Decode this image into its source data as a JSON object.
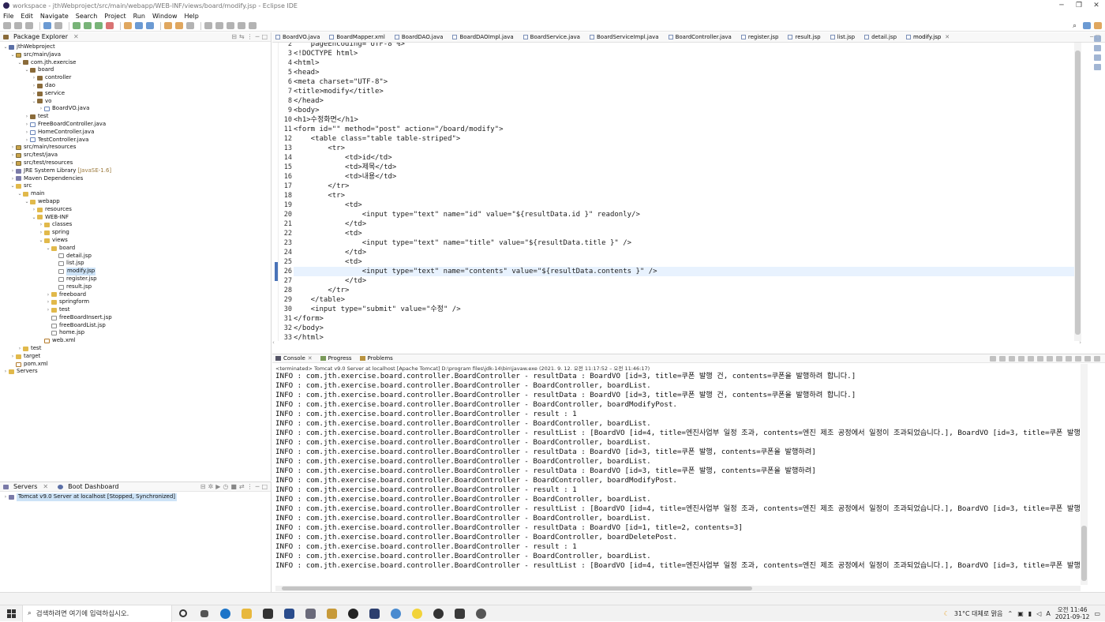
{
  "window": {
    "title": "workspace - jthWebproject/src/main/webapp/WEB-INF/views/board/modify.jsp - Eclipse IDE"
  },
  "menu": [
    "File",
    "Edit",
    "Navigate",
    "Search",
    "Project",
    "Run",
    "Window",
    "Help"
  ],
  "package_explorer": {
    "title": "Package Explorer",
    "tree": [
      {
        "label": "jthWebproject",
        "depth": 0,
        "icon": "project-icon",
        "expanded": true
      },
      {
        "label": "src/main/java",
        "depth": 1,
        "icon": "source-folder-icon",
        "expanded": true
      },
      {
        "label": "com.jth.exercise",
        "depth": 2,
        "icon": "package-icon",
        "expanded": true
      },
      {
        "label": "board",
        "depth": 3,
        "icon": "package-icon",
        "expanded": true
      },
      {
        "label": "controller",
        "depth": 4,
        "icon": "package-icon",
        "expanded": false
      },
      {
        "label": "dao",
        "depth": 4,
        "icon": "package-icon",
        "expanded": false
      },
      {
        "label": "service",
        "depth": 4,
        "icon": "package-icon",
        "expanded": false
      },
      {
        "label": "vo",
        "depth": 4,
        "icon": "package-icon",
        "expanded": true
      },
      {
        "label": "BoardVO.java",
        "depth": 5,
        "icon": "java-file-icon",
        "expanded": false
      },
      {
        "label": "test",
        "depth": 3,
        "icon": "package-icon",
        "expanded": false
      },
      {
        "label": "FreeBoardController.java",
        "depth": 3,
        "icon": "java-file-icon",
        "expanded": false
      },
      {
        "label": "HomeController.java",
        "depth": 3,
        "icon": "java-file-icon",
        "expanded": false
      },
      {
        "label": "TestController.java",
        "depth": 3,
        "icon": "java-file-icon",
        "expanded": false
      },
      {
        "label": "src/main/resources",
        "depth": 1,
        "icon": "source-folder-icon",
        "expanded": false
      },
      {
        "label": "src/test/java",
        "depth": 1,
        "icon": "source-folder-icon",
        "expanded": false
      },
      {
        "label": "src/test/resources",
        "depth": 1,
        "icon": "source-folder-icon",
        "expanded": false
      },
      {
        "label": "JRE System Library",
        "tag": "[JavaSE-1.6]",
        "depth": 1,
        "icon": "library-icon",
        "expanded": false
      },
      {
        "label": "Maven Dependencies",
        "depth": 1,
        "icon": "library-icon",
        "expanded": false
      },
      {
        "label": "src",
        "depth": 1,
        "icon": "folder-icon",
        "expanded": true
      },
      {
        "label": "main",
        "depth": 2,
        "icon": "folder-icon",
        "expanded": true
      },
      {
        "label": "webapp",
        "depth": 3,
        "icon": "folder-icon",
        "expanded": true
      },
      {
        "label": "resources",
        "depth": 4,
        "icon": "folder-icon",
        "expanded": false
      },
      {
        "label": "WEB-INF",
        "depth": 4,
        "icon": "folder-icon",
        "expanded": true
      },
      {
        "label": "classes",
        "depth": 5,
        "icon": "folder-icon",
        "expanded": false
      },
      {
        "label": "spring",
        "depth": 5,
        "icon": "folder-icon",
        "expanded": false
      },
      {
        "label": "views",
        "depth": 5,
        "icon": "folder-icon",
        "expanded": true
      },
      {
        "label": "board",
        "depth": 6,
        "icon": "folder-icon",
        "expanded": true
      },
      {
        "label": "detail.jsp",
        "depth": 7,
        "icon": "jsp-file-icon",
        "expanded": false
      },
      {
        "label": "list.jsp",
        "depth": 7,
        "icon": "jsp-file-icon",
        "expanded": false
      },
      {
        "label": "modify.jsp",
        "depth": 7,
        "icon": "jsp-file-icon",
        "expanded": false,
        "selected": true
      },
      {
        "label": "register.jsp",
        "depth": 7,
        "icon": "jsp-file-icon",
        "expanded": false
      },
      {
        "label": "result.jsp",
        "depth": 7,
        "icon": "jsp-file-icon",
        "expanded": false
      },
      {
        "label": "freeboard",
        "depth": 6,
        "icon": "folder-icon",
        "expanded": false
      },
      {
        "label": "springform",
        "depth": 6,
        "icon": "folder-icon",
        "expanded": false
      },
      {
        "label": "test",
        "depth": 6,
        "icon": "folder-icon",
        "expanded": false
      },
      {
        "label": "freeBoardInsert.jsp",
        "depth": 6,
        "icon": "jsp-file-icon",
        "expanded": false
      },
      {
        "label": "freeBoardList.jsp",
        "depth": 6,
        "icon": "jsp-file-icon",
        "expanded": false
      },
      {
        "label": "home.jsp",
        "depth": 6,
        "icon": "jsp-file-icon",
        "expanded": false
      },
      {
        "label": "web.xml",
        "depth": 5,
        "icon": "xml-file-icon",
        "expanded": false
      },
      {
        "label": "test",
        "depth": 2,
        "icon": "folder-icon",
        "expanded": false
      },
      {
        "label": "target",
        "depth": 1,
        "icon": "folder-icon",
        "expanded": false
      },
      {
        "label": "pom.xml",
        "depth": 1,
        "icon": "xml-file-icon",
        "expanded": false
      },
      {
        "label": "Servers",
        "depth": 0,
        "icon": "folder-icon",
        "expanded": false
      }
    ]
  },
  "servers_panel": {
    "tabs": [
      "Servers",
      "Boot Dashboard"
    ],
    "server": "Tomcat v9.0 Server at localhost  [Stopped, Synchronized]"
  },
  "editor": {
    "tabs": [
      "BoardVO.java",
      "BoardMapper.xml",
      "BoardDAO.java",
      "BoardDAOImpl.java",
      "BoardService.java",
      "BoardServiceImpl.java",
      "BoardController.java",
      "register.jsp",
      "result.jsp",
      "list.jsp",
      "detail.jsp",
      "modify.jsp"
    ],
    "active_tab": "modify.jsp",
    "current_line": 26,
    "lines": [
      {
        "n": "2",
        "text": "    pageEncoding=\"UTF-8\"%>"
      },
      {
        "n": "3",
        "text": "<!DOCTYPE html>"
      },
      {
        "n": "4",
        "text": "<html>"
      },
      {
        "n": "5",
        "text": "<head>"
      },
      {
        "n": "6",
        "text": "<meta charset=\"UTF-8\">"
      },
      {
        "n": "7",
        "text": "<title>modify</title>"
      },
      {
        "n": "8",
        "text": "</head>"
      },
      {
        "n": "9",
        "text": "<body>"
      },
      {
        "n": "10",
        "text": "<h1>수정화면</h1>"
      },
      {
        "n": "11",
        "text": "<form id=\"\" method=\"post\" action=\"/board/modify\">"
      },
      {
        "n": "12",
        "text": "    <table class=\"table table-striped\">"
      },
      {
        "n": "13",
        "text": "        <tr>"
      },
      {
        "n": "14",
        "text": "            <td>id</td>"
      },
      {
        "n": "15",
        "text": "            <td>제목</td>"
      },
      {
        "n": "16",
        "text": "            <td>내용</td>"
      },
      {
        "n": "17",
        "text": "        </tr>"
      },
      {
        "n": "18",
        "text": "        <tr>"
      },
      {
        "n": "19",
        "text": "            <td>"
      },
      {
        "n": "20",
        "text": "                <input type=\"text\" name=\"id\" value=\"${resultData.id }\" readonly/>"
      },
      {
        "n": "21",
        "text": "            </td>"
      },
      {
        "n": "22",
        "text": "            <td>"
      },
      {
        "n": "23",
        "text": "                <input type=\"text\" name=\"title\" value=\"${resultData.title }\" />"
      },
      {
        "n": "24",
        "text": "            </td>"
      },
      {
        "n": "25",
        "text": "            <td>"
      },
      {
        "n": "26",
        "text": "                <input type=\"text\" name=\"contents\" value=\"${resultData.contents }\" />"
      },
      {
        "n": "27",
        "text": "            </td>"
      },
      {
        "n": "28",
        "text": "        </tr>"
      },
      {
        "n": "29",
        "text": "    </table>"
      },
      {
        "n": "30",
        "text": "    <input type=\"submit\" value=\"수정\" />"
      },
      {
        "n": "31",
        "text": "</form>"
      },
      {
        "n": "32",
        "text": "</body>"
      },
      {
        "n": "33",
        "text": "</html>"
      }
    ]
  },
  "console": {
    "tabs": [
      "Console",
      "Progress",
      "Problems"
    ],
    "terminated": "<terminated> Tomcat v9.0 Server at localhost [Apache Tomcat] D:\\program files\\jdk-14\\bin\\javaw.exe  (2021. 9. 12. 오전 11:17:52 – 오전 11:46:17)",
    "lines": [
      "INFO : com.jth.exercise.board.controller.BoardController - resultData : BoardVO [id=3, title=쿠폰 발행 건, contents=쿠폰을 발행하려 합니다.]",
      "INFO : com.jth.exercise.board.controller.BoardController - BoardController, boardList.",
      "INFO : com.jth.exercise.board.controller.BoardController - resultData : BoardVO [id=3, title=쿠폰 발행 건, contents=쿠폰을 발행하려 합니다.]",
      "INFO : com.jth.exercise.board.controller.BoardController - BoardController, boardModifyPost.",
      "INFO : com.jth.exercise.board.controller.BoardController - result : 1",
      "INFO : com.jth.exercise.board.controller.BoardController - BoardController, boardList.",
      "INFO : com.jth.exercise.board.controller.BoardController - resultList : [BoardVO [id=4, title=엔진사업부 일정 조과, contents=엔진 제조 공정에서 일정이 조과되었습니다.], BoardVO [id=3, title=쿠폰 발행, conte",
      "INFO : com.jth.exercise.board.controller.BoardController - BoardController, boardList.",
      "INFO : com.jth.exercise.board.controller.BoardController - resultData : BoardVO [id=3, title=쿠폰 발행, contents=쿠폰을 발행하려]",
      "INFO : com.jth.exercise.board.controller.BoardController - BoardController, boardList.",
      "INFO : com.jth.exercise.board.controller.BoardController - resultData : BoardVO [id=3, title=쿠폰 발행, contents=쿠폰을 발행하려]",
      "INFO : com.jth.exercise.board.controller.BoardController - BoardController, boardModifyPost.",
      "INFO : com.jth.exercise.board.controller.BoardController - result : 1",
      "INFO : com.jth.exercise.board.controller.BoardController - BoardController, boardList.",
      "INFO : com.jth.exercise.board.controller.BoardController - resultList : [BoardVO [id=4, title=엔진사업부 일정 조과, contents=엔진 제조 공정에서 일정이 조과되었습니다.], BoardVO [id=3, title=쿠폰 발행333, co",
      "INFO : com.jth.exercise.board.controller.BoardController - BoardController, boardList.",
      "INFO : com.jth.exercise.board.controller.BoardController - resultData : BoardVO [id=1, title=2, contents=3]",
      "INFO : com.jth.exercise.board.controller.BoardController - BoardController, boardDeletePost.",
      "INFO : com.jth.exercise.board.controller.BoardController - result : 1",
      "INFO : com.jth.exercise.board.controller.BoardController - BoardController, boardList.",
      "INFO : com.jth.exercise.board.controller.BoardController - resultList : [BoardVO [id=4, title=엔진사업부 일정 조과, contents=엔진 제조 공정에서 일정이 조과되었습니다.], BoardVO [id=3, title=쿠폰 발행333, co"
    ]
  },
  "taskbar": {
    "search_placeholder": "검색하려면 여기에 입력하십시오.",
    "weather": "31°C 대체로 맑음",
    "time": "오전 11:46",
    "date": "2021-09-12"
  },
  "colors": {
    "selection": "#cde3f7",
    "current_line": "#e8f2fe",
    "string": "#2a2adf",
    "tag": "#1f1f8f"
  }
}
